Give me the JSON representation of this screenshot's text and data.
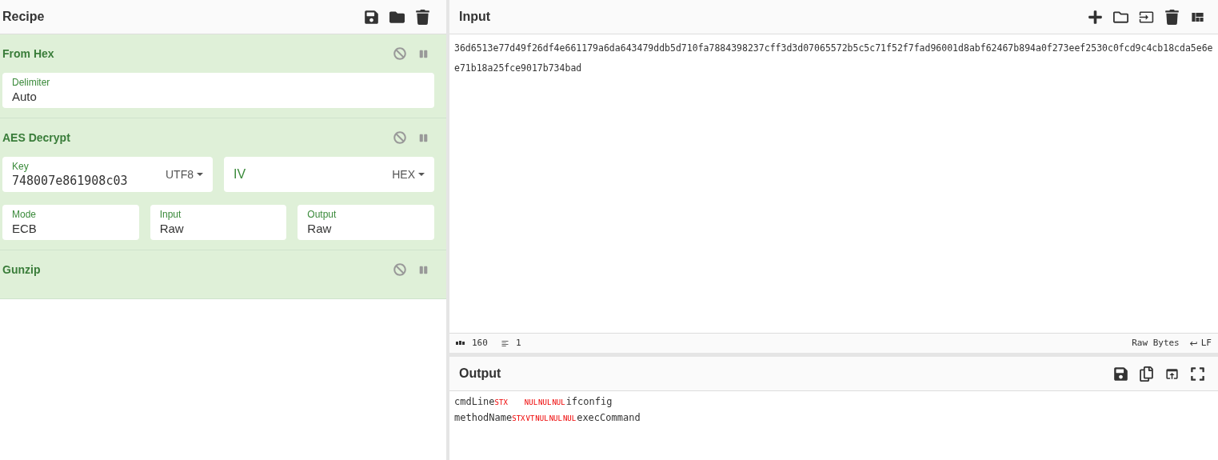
{
  "recipe": {
    "title": "Recipe",
    "operations": [
      {
        "name": "From Hex",
        "disabled": false,
        "paused": false,
        "fields": [
          {
            "kind": "full",
            "label": "Delimiter",
            "value": "Auto"
          }
        ]
      },
      {
        "name": "AES Decrypt",
        "disabled": false,
        "paused": false,
        "fields": [
          {
            "kind": "key",
            "label": "Key",
            "value": "748007e861908c03",
            "option": "UTF8"
          },
          {
            "kind": "half",
            "placeholder": "IV",
            "option": "HEX"
          },
          {
            "kind": "third",
            "label": "Mode",
            "value": "ECB"
          },
          {
            "kind": "third",
            "label": "Input",
            "value": "Raw"
          },
          {
            "kind": "third",
            "label": "Output",
            "value": "Raw"
          }
        ]
      },
      {
        "name": "Gunzip",
        "disabled": false,
        "paused": false
      }
    ]
  },
  "input": {
    "title": "Input",
    "text": "36d6513e77d49f26df4e661179a6da643479ddb5d710fa7884398237cff3d3d07065572b5c5c71f52f7fad96001d8abf62467b894a0f273eef2530c0fcd9c4cb18cda5e6ee71b18a25fce9017b734bad"
  },
  "status_bar": {
    "length": "160",
    "lines": "1",
    "encoding": "Raw Bytes",
    "eol": "LF"
  },
  "output": {
    "title": "Output",
    "lines": [
      [
        {
          "kind": "text",
          "text": "cmdLine"
        },
        {
          "kind": "ctrl",
          "text": "STX"
        },
        {
          "kind": "tab"
        },
        {
          "kind": "ctrl",
          "text": "NUL"
        },
        {
          "kind": "ctrl",
          "text": "NUL"
        },
        {
          "kind": "ctrl",
          "text": "NUL"
        },
        {
          "kind": "text",
          "text": "ifconfig"
        }
      ],
      [
        {
          "kind": "text",
          "text": "methodName"
        },
        {
          "kind": "ctrl",
          "text": "STX"
        },
        {
          "kind": "ctrl",
          "text": "VT"
        },
        {
          "kind": "ctrl",
          "text": "NUL"
        },
        {
          "kind": "ctrl",
          "text": "NUL"
        },
        {
          "kind": "ctrl",
          "text": "NUL"
        },
        {
          "kind": "text",
          "text": "execCommand"
        }
      ]
    ]
  }
}
